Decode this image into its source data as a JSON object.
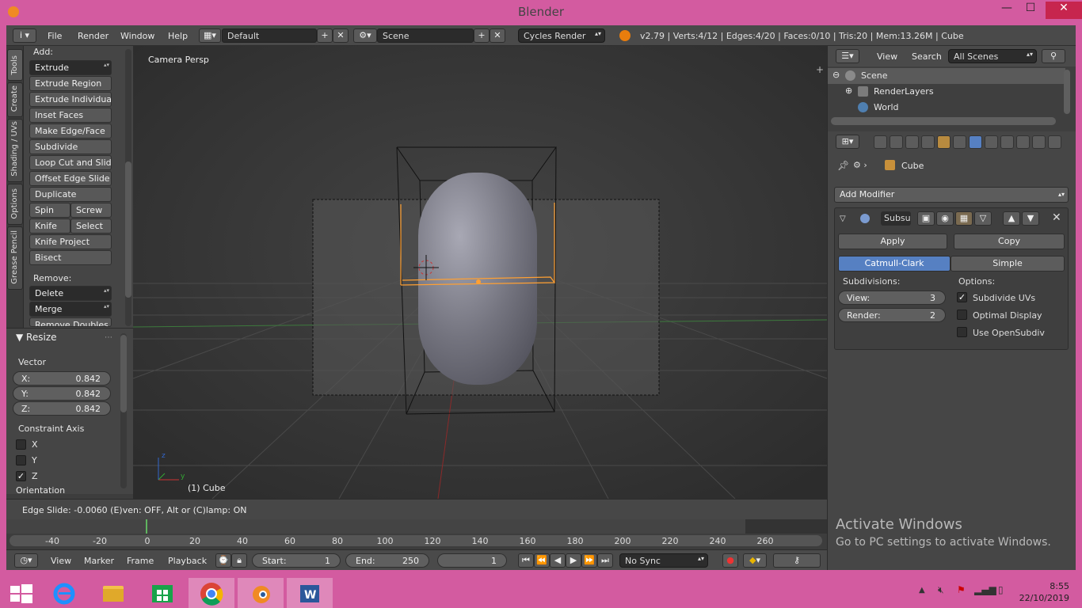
{
  "window": {
    "title": "Blender",
    "minimize": "—",
    "maximize": "☐",
    "close": "✕"
  },
  "header": {
    "info_icon": "i",
    "menus": [
      "File",
      "Render",
      "Window",
      "Help"
    ],
    "screen_layout": "Default",
    "scene": "Scene",
    "render_engine": "Cycles Render",
    "stats": "v2.79 | Verts:4/12 | Edges:4/20 | Faces:0/10 | Tris:20 | Mem:13.26M | Cube"
  },
  "tabs": [
    "Tools",
    "Create",
    "Shading / UVs",
    "Options",
    "Grease Pencil"
  ],
  "toolshelf": {
    "add_label": "Add:",
    "extrude": "Extrude",
    "buttons": [
      "Extrude Region",
      "Extrude Individual",
      "Inset Faces",
      "Make Edge/Face",
      "Subdivide",
      "Loop Cut and Slide",
      "Offset Edge Slide",
      "Duplicate"
    ],
    "spin": "Spin",
    "screw": "Screw",
    "knife": "Knife",
    "select": "Select",
    "knife_project": "Knife Project",
    "bisect": "Bisect",
    "remove_label": "Remove:",
    "delete": "Delete",
    "merge": "Merge",
    "remove_doubles": "Remove Doubles"
  },
  "resize": {
    "title": "Resize",
    "vector_label": "Vector",
    "x_label": "X:",
    "x": "0.842",
    "y_label": "Y:",
    "y": "0.842",
    "z_label": "Z:",
    "z": "0.842",
    "constraint_label": "Constraint Axis",
    "axes": [
      {
        "name": "X",
        "checked": false
      },
      {
        "name": "Y",
        "checked": false
      },
      {
        "name": "Z",
        "checked": true
      }
    ],
    "orientation_label": "Orientation"
  },
  "viewport": {
    "view_label": "Camera Persp",
    "object_label": "(1) Cube",
    "axis_x": "x",
    "axis_y": "y",
    "axis_z": "z"
  },
  "status": {
    "text": "Edge Slide: -0.0060 (E)ven: OFF, Alt or (C)lamp: ON"
  },
  "timeline": {
    "ticks": [
      "-40",
      "-20",
      "0",
      "20",
      "40",
      "60",
      "80",
      "100",
      "120",
      "140",
      "160",
      "180",
      "200",
      "220",
      "240",
      "260"
    ],
    "current_frame_marker": 0,
    "menus": [
      "View",
      "Marker",
      "Frame",
      "Playback"
    ],
    "start_label": "Start:",
    "start": "1",
    "end_label": "End:",
    "end": "250",
    "current": "1",
    "sync": "No Sync"
  },
  "outliner": {
    "menus": [
      "View",
      "Search"
    ],
    "filter": "All Scenes",
    "tree": [
      "Scene",
      "RenderLayers",
      "World"
    ]
  },
  "properties": {
    "object_name": "Cube",
    "add_modifier": "Add Modifier",
    "modifier_name": "Subsu",
    "apply": "Apply",
    "copy": "Copy",
    "catmull": "Catmull-Clark",
    "simple": "Simple",
    "subdivisions_label": "Subdivisions:",
    "view_label": "View:",
    "view_value": "3",
    "render_label": "Render:",
    "render_value": "2",
    "options_label": "Options:",
    "options": [
      {
        "label": "Subdivide UVs",
        "checked": true
      },
      {
        "label": "Optimal Display",
        "checked": false
      },
      {
        "label": "Use OpenSubdiv",
        "checked": false
      }
    ]
  },
  "activate_windows": {
    "title": "Activate Windows",
    "subtitle": "Go to PC settings to activate Windows."
  },
  "taskbar": {
    "time": "8:55",
    "date": "22/10/2019"
  },
  "colors": {
    "accent_blue": "#5680c2",
    "selected_orange": "#ffa033",
    "taskbar": "#d35ba0"
  }
}
